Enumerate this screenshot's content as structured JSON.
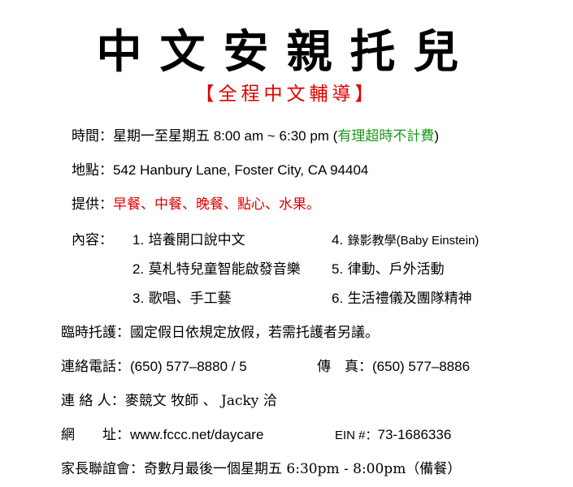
{
  "title": "中文安親托兒",
  "subtitle": "【全程中文輔導】",
  "hours": {
    "label": "時間：",
    "value": "星期一至星期五 8:00 am ~ 6:30 pm (",
    "note": "有理超時不計費",
    "close": ")"
  },
  "address": {
    "label": "地點：",
    "value": "542 Hanbury Lane, Foster City, CA 94404"
  },
  "provided": {
    "label": "提供：",
    "value": "早餐、中餐、晚餐、點心、水果。"
  },
  "content": {
    "label": "內容：",
    "items": [
      {
        "num": "1.",
        "text": "培養開口說中文"
      },
      {
        "num": "2.",
        "text": "莫札特兒童智能啟發音樂"
      },
      {
        "num": "3.",
        "text": "歌唱、手工藝"
      },
      {
        "num": "4.",
        "text": "錄影教學(Baby Einstein)"
      },
      {
        "num": "5.",
        "text": "律動、戶外活動"
      },
      {
        "num": "6.",
        "text": "生活禮儀及團隊精神"
      }
    ]
  },
  "temp_care": {
    "label": "臨時托護：",
    "value": "國定假日依規定放假，若需托護者另議。"
  },
  "phone": {
    "label": "連絡電話：",
    "value": "(650) 577–8880 / 5",
    "fax_label": "傳　真：",
    "fax_value": "(650) 577–8886"
  },
  "contact": {
    "label": "連 絡 人：",
    "value": "麥競文 牧師 、 Jacky 洽"
  },
  "website": {
    "label": "網　　址：",
    "value": "www.fccc.net/daycare",
    "ein_label": "EIN #：",
    "ein_value": "73-1686336"
  },
  "parents_meeting": {
    "label": "家長聯誼會：",
    "value": "奇數月最後一個星期五 6:30pm - 8:00pm（備餐）"
  }
}
